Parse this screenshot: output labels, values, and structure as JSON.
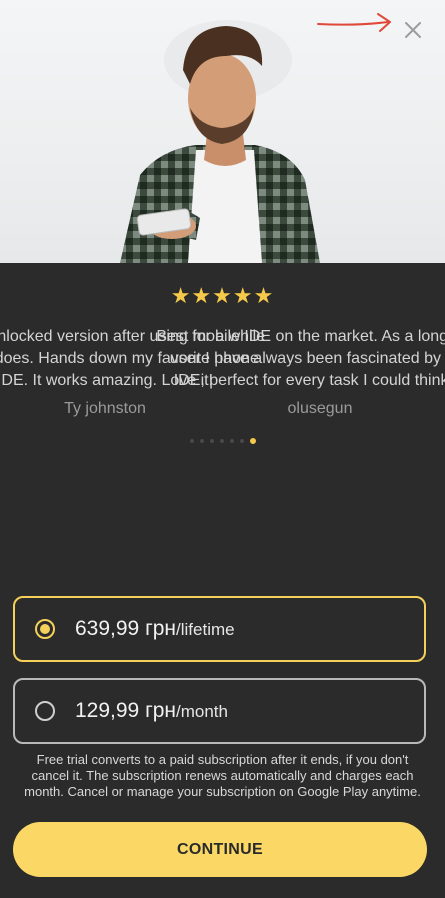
{
  "hero": {
    "image_alt": "man-looking-at-phone"
  },
  "close_button": {
    "icon": "close-icon"
  },
  "rating": {
    "stars_text": "★★★★★",
    "stars": 5
  },
  "reviews": [
    {
      "body": "It has unlocked version after using for a while and it does. Hands down my favorite phone IDE. It works amazing. Love it!",
      "author": "Ty johnston"
    },
    {
      "body": "Best mobile IDE on the market. As a long-time user I have always been fascinated by this IDE, perfect for every task I could think of",
      "author": "olusegun"
    }
  ],
  "carousel": {
    "count": 7,
    "active_index": 6
  },
  "plans": [
    {
      "price": "639,99 грн",
      "period": "/lifetime",
      "selected": true
    },
    {
      "price": "129,99 грн",
      "period": "/month",
      "selected": false
    }
  ],
  "disclaimer": "Free trial converts to a paid subscription after it ends, if you don't cancel it. The subscription renews automatically and charges each month. Cancel or manage your subscription on Google Play anytime.",
  "cta": {
    "label": "CONTINUE"
  },
  "colors": {
    "accent": "#f5d05a",
    "background": "#2b2b2b",
    "annotation": "#e0493a"
  }
}
